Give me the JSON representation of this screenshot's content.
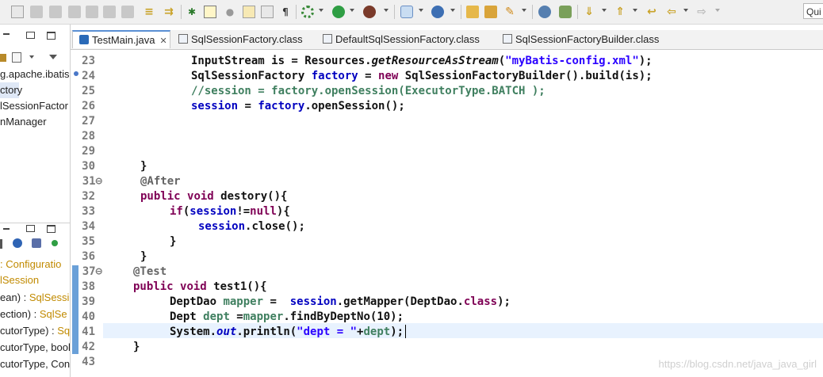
{
  "toolbar": {
    "quick_access": "Qui",
    "icons": [
      "skip-breakpoints",
      "resume",
      "suspend",
      "terminate",
      "disconnect",
      "step-into",
      "step-over",
      "step-return",
      "drop-to-frame",
      "use-step-filters",
      "toggle-breakpoint",
      "toggle-mark-occurrences",
      "show-whitespace",
      "block-selection",
      "pin-editor",
      "show-source",
      "debug",
      "run",
      "run-external",
      "new-java-project",
      "new-package",
      "new-class",
      "open-type",
      "open-task",
      "search",
      "next-annotation",
      "previous-annotation",
      "last-edit",
      "back",
      "forward"
    ]
  },
  "left_panel": {
    "package_explorer": [
      {
        "text": "g.apache.ibatis",
        "indent": 0,
        "selected": false
      },
      {
        "text": "ctory",
        "indent": 0,
        "selected": true
      },
      {
        "text": "lSessionFactor",
        "indent": 0,
        "selected": false
      },
      {
        "text": "nManager",
        "indent": 0,
        "selected": false
      }
    ],
    "outline": [
      {
        "text": ": Configuratio",
        "type": ""
      },
      {
        "text": "lSession",
        "type": ""
      },
      {
        "text": "ean) : ",
        "type": "SqlSessi"
      },
      {
        "text": "ection) : ",
        "type": "SqlSe"
      },
      {
        "text": "cutorType) : ",
        "type": "Sql"
      },
      {
        "text": "cutorType, bool",
        "type": ""
      },
      {
        "text": "cutorType, Conr",
        "type": ""
      }
    ]
  },
  "editor": {
    "tabs": [
      {
        "label": "TestMain.java",
        "active": true,
        "closable": true,
        "icon": "java-file-icon"
      },
      {
        "label": "SqlSessionFactory.class",
        "active": false,
        "closable": false,
        "icon": "class-file-icon"
      },
      {
        "label": "DefaultSqlSessionFactory.class",
        "active": false,
        "closable": false,
        "icon": "class-file-icon"
      },
      {
        "label": "SqlSessionFactoryBuilder.class",
        "active": false,
        "closable": false,
        "icon": "class-file-icon"
      }
    ],
    "line_numbers": [
      "23",
      "24",
      "25",
      "26",
      "27",
      "28",
      "29",
      "30",
      "31⊖",
      "32",
      "33",
      "34",
      "35",
      "36",
      "37⊖",
      "38",
      "39",
      "40",
      "41",
      "42",
      "43"
    ],
    "current_line": "41",
    "watermark": "https://blog.csdn.net/java_java_girl"
  }
}
